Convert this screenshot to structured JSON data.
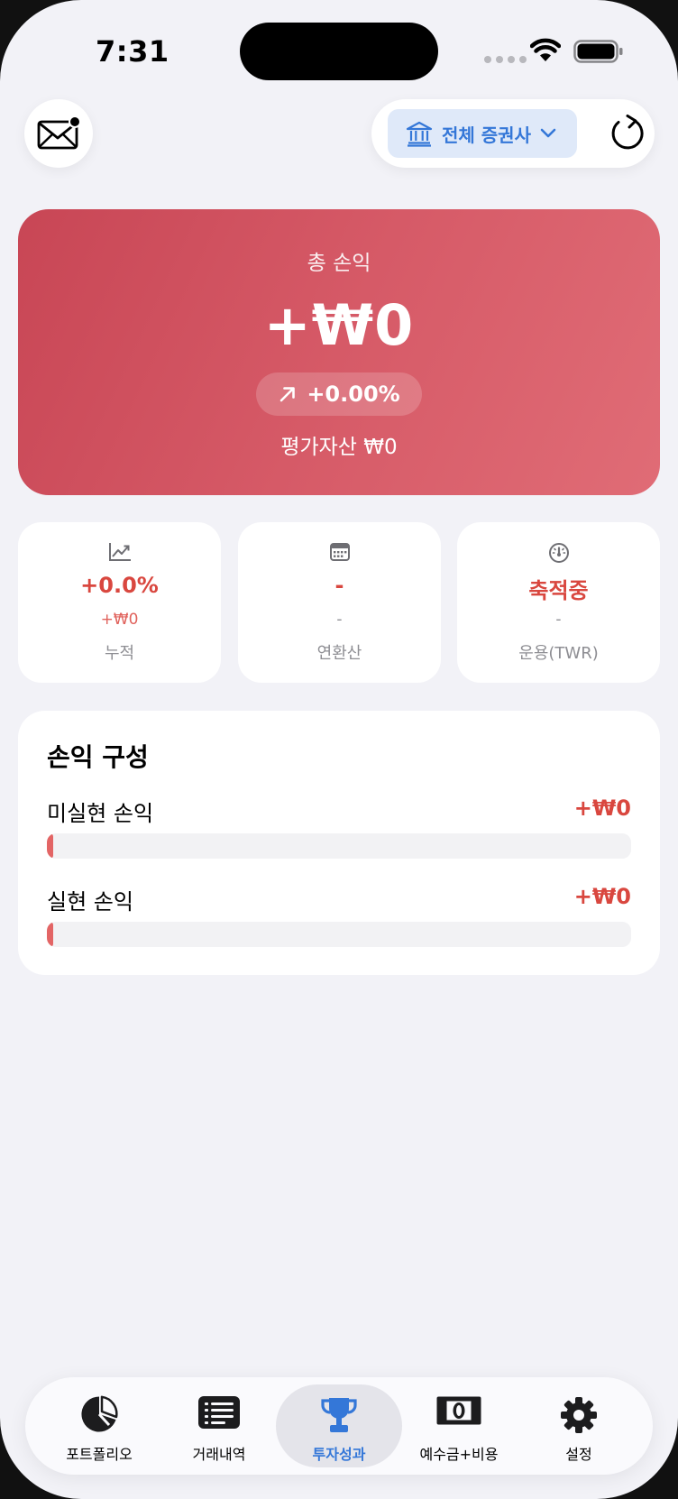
{
  "status_bar": {
    "time": "7:31"
  },
  "header": {
    "broker_select_label": "전체 증권사"
  },
  "hero": {
    "label": "총 손익",
    "value": "+₩0",
    "percent": "+0.00%",
    "asset_label": "평가자산 ₩0"
  },
  "stats": [
    {
      "icon": "trend-chart-icon",
      "value": "+0.0%",
      "sub": "+₩0",
      "caption": "누적"
    },
    {
      "icon": "calendar-icon",
      "value": "-",
      "sub": "-",
      "caption": "연환산"
    },
    {
      "icon": "gauge-icon",
      "value": "축적중",
      "sub": "-",
      "caption": "운용(TWR)"
    }
  ],
  "breakdown": {
    "title": "손익 구성",
    "rows": [
      {
        "label": "미실현 손익",
        "value": "+₩0",
        "fill_fraction": 0
      },
      {
        "label": "실현 손익",
        "value": "+₩0",
        "fill_fraction": 0
      }
    ]
  },
  "tabs": [
    {
      "label": "포트폴리오",
      "icon": "pie-chart-icon",
      "active": false
    },
    {
      "label": "거래내역",
      "icon": "list-icon",
      "active": false
    },
    {
      "label": "투자성과",
      "icon": "trophy-icon",
      "active": true
    },
    {
      "label": "예수금+비용",
      "icon": "banknote-icon",
      "active": false
    },
    {
      "label": "설정",
      "icon": "gear-icon",
      "active": false
    }
  ],
  "colors": {
    "accent_blue": "#3477d8",
    "profit_red": "#d9473f",
    "hero_gradient_start": "#c84655",
    "hero_gradient_end": "#e06c76",
    "background": "#f2f2f7"
  }
}
